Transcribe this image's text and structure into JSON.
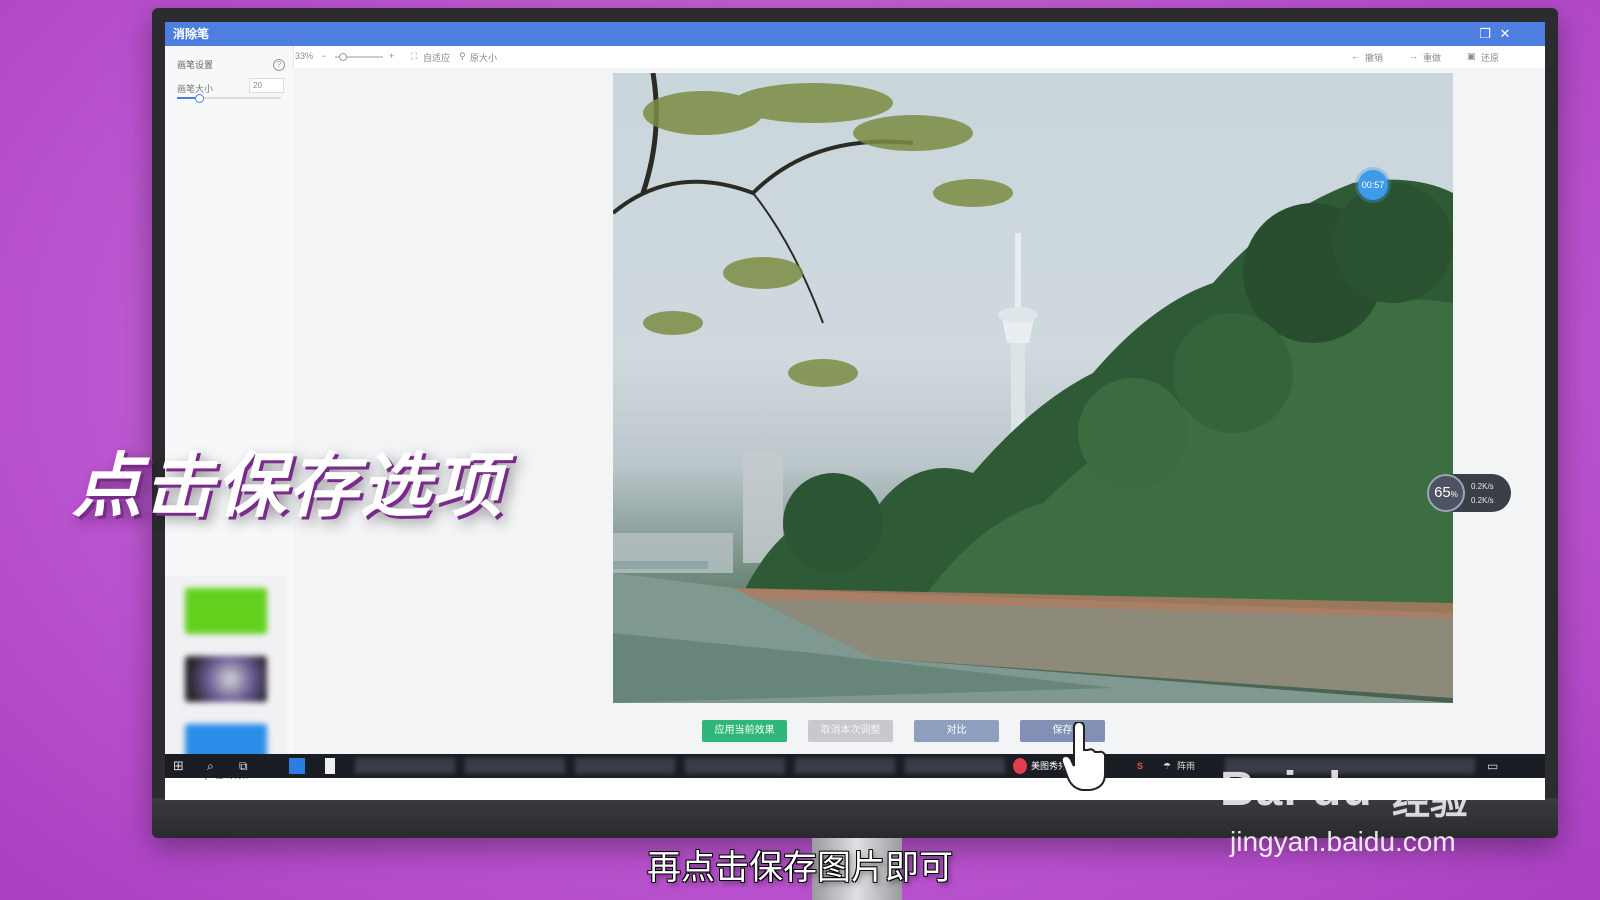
{
  "window": {
    "title": "消除笔",
    "restore_icon": "restore-icon",
    "close_label": "✕"
  },
  "sidebar": {
    "section_title": "画笔设置",
    "brush_size_label": "画笔大小",
    "brush_size_value": "20",
    "brush_size_level": 20,
    "thumbnails_caption": "ps在线制作"
  },
  "toolbar": {
    "zoom": "33%",
    "zoom_out": "−",
    "zoom_in": "+",
    "fit": "自适应",
    "original_size": "原大小",
    "undo": "撤销",
    "redo": "重做",
    "restore": "还原"
  },
  "actions": {
    "apply": "应用当前效果",
    "cancel": "取消本次调整",
    "compare": "对比",
    "save": "保存"
  },
  "overlays": {
    "timer": "00:57",
    "cpu_percent": "65",
    "cpu_unit": "%",
    "net_up": "0.2K/s",
    "net_down": "0.2K/s"
  },
  "taskbar": {
    "active_app": "美图秀秀",
    "tray_app": "阵雨"
  },
  "video": {
    "caption_big": "点击保存选项",
    "subtitle": "再点击保存图片即可",
    "watermark_logo": "Bai du",
    "watermark_cn": "经验",
    "watermark_url": "jingyan.baidu.com"
  },
  "colors": {
    "titlebar": "#4e7fe0",
    "apply_button": "#2fb67a",
    "background": "#c45fd6"
  }
}
